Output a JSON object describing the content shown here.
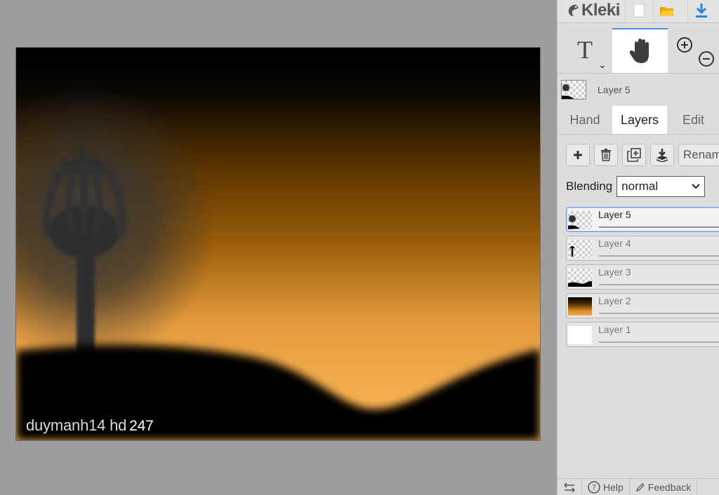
{
  "app": {
    "name": "Kleki"
  },
  "canvas": {
    "signature": "duymanh14 hd",
    "signature_number": "247"
  },
  "toolbar": {
    "new_icon": "new-document-icon",
    "open_icon": "folder-open-icon",
    "save_icon": "download-icon"
  },
  "tools": {
    "text_tool_letter": "T",
    "text_tool_chevron": "⌄",
    "hand_icon": "hand-icon",
    "zoom_in_icon": "zoom-in-icon",
    "zoom_out_icon": "zoom-out-icon"
  },
  "current_layer": {
    "name": "Layer 5"
  },
  "tabs": [
    {
      "label": "Hand"
    },
    {
      "label": "Layers",
      "active": true
    },
    {
      "label": "Edit"
    }
  ],
  "layer_actions": {
    "add_icon": "plus-icon",
    "delete_icon": "trash-icon",
    "duplicate_icon": "duplicate-icon",
    "merge_icon": "merge-down-icon",
    "rename_label": "Renam"
  },
  "blending": {
    "label": "Blending",
    "value": "normal"
  },
  "layers": [
    {
      "name": "Layer 5",
      "active": true
    },
    {
      "name": "Layer 4"
    },
    {
      "name": "Layer 3"
    },
    {
      "name": "Layer 2"
    },
    {
      "name": "Layer 1"
    }
  ],
  "bottom": {
    "help_label": "Help",
    "feedback_label": "Feedback"
  },
  "colors": {
    "accent": "#4d8ef0",
    "sky_dark": "#000000",
    "sky_mid": "#8a5200",
    "sky_light": "#f5a94a"
  }
}
